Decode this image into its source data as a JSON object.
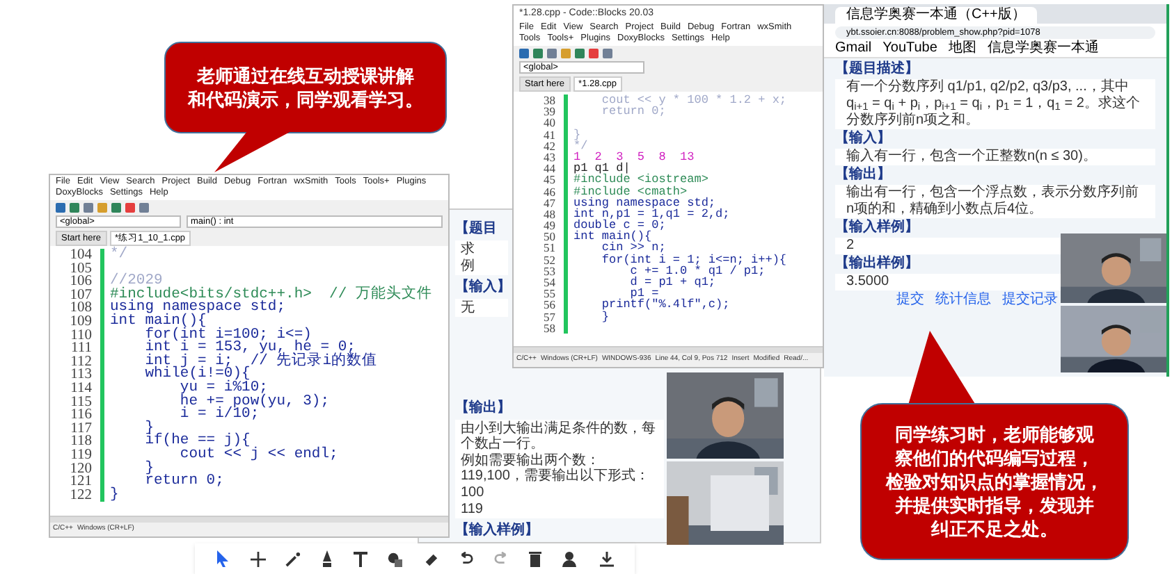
{
  "callouts": [
    {
      "lines": [
        "老师通过在线互动授课讲解",
        "和代码演示，同学观看学习。"
      ]
    },
    {
      "lines": [
        "同学练习时，老师能够观",
        "察他们的代码编写过程，",
        "检验对知识点的掌握情况，",
        "并提供实时指导，发现并",
        "纠正不足之处。"
      ]
    }
  ],
  "back_page": {
    "sections": [
      {
        "heading": "【题目",
        "body": [
          "求",
          "例"
        ]
      },
      {
        "heading": "【输入】",
        "body": [
          "无"
        ]
      },
      {
        "heading": "【输出】",
        "body": [
          "由小到大输出满足条件的数，每个数占一行。",
          "例如需要输出两个数：119,100，需要输出以下形式：",
          "100",
          "119"
        ]
      },
      {
        "heading": "【输入样例】"
      }
    ]
  },
  "left_editor": {
    "menu": [
      "File",
      "Edit",
      "View",
      "Search",
      "Project",
      "Build",
      "Debug",
      "Fortran",
      "wxSmith",
      "Tools",
      "Tools+",
      "Plugins",
      "DoxyBlocks",
      "Settings",
      "Help"
    ],
    "scope": "<global>",
    "function": "main() : int",
    "tabs": [
      {
        "label": "Start here",
        "selected": false
      },
      {
        "label": "*练习1_10_1.cpp",
        "selected": true
      }
    ],
    "lines": [
      {
        "no": "104",
        "kind": "comment",
        "text": "*/"
      },
      {
        "no": "105"
      },
      {
        "no": "106",
        "kind": "comment",
        "text": "//2029"
      },
      {
        "no": "107",
        "kind": "preproc",
        "text": "#include<bits/stdc++.h>  // 万能头文件"
      },
      {
        "no": "108",
        "kind": "code",
        "text": "using namespace std;"
      },
      {
        "no": "109",
        "kind": "code",
        "text": "int main(){"
      },
      {
        "no": "110",
        "kind": "code",
        "text": "    for(int i=100; i<=)"
      },
      {
        "no": "111",
        "kind": "code",
        "text": "    int i = 153, yu, he = 0;"
      },
      {
        "no": "112",
        "kind": "code",
        "text": "    int j = i;  // 先记录i的数值"
      },
      {
        "no": "113",
        "kind": "code",
        "text": "    while(i!=0){"
      },
      {
        "no": "114",
        "kind": "code",
        "text": "        yu = i%10;"
      },
      {
        "no": "115",
        "kind": "code",
        "text": "        he += pow(yu, 3);"
      },
      {
        "no": "116",
        "kind": "code",
        "text": "        i = i/10;"
      },
      {
        "no": "117",
        "kind": "code",
        "text": "    }"
      },
      {
        "no": "118",
        "kind": "code",
        "text": "    if(he == j){"
      },
      {
        "no": "119",
        "kind": "code",
        "text": "        cout << j << endl;"
      },
      {
        "no": "120",
        "kind": "code",
        "text": "    }"
      },
      {
        "no": "121",
        "kind": "code",
        "text": "    return 0;"
      },
      {
        "no": "122",
        "kind": "code",
        "text": "}"
      }
    ],
    "status": [
      "C/C++",
      "Windows (CR+LF)"
    ]
  },
  "mid_editor": {
    "title": "*1.28.cpp - Code::Blocks 20.03",
    "menu": [
      "File",
      "Edit",
      "View",
      "Search",
      "Project",
      "Build",
      "Debug",
      "Fortran",
      "wxSmith",
      "Tools",
      "Tools+",
      "Plugins",
      "DoxyBlocks",
      "Settings",
      "Help"
    ],
    "scope": "<global>",
    "tabs": [
      {
        "label": "Start here",
        "selected": false
      },
      {
        "label": "*1.28.cpp",
        "selected": true
      }
    ],
    "lines": [
      {
        "no": "38",
        "kind": "comment",
        "text": "    cout << y * 100 * 1.2 + x;"
      },
      {
        "no": "39",
        "kind": "comment",
        "text": "    return 0;"
      },
      {
        "no": "40"
      },
      {
        "no": "41",
        "kind": "comment",
        "text": "}"
      },
      {
        "no": "42",
        "kind": "comment",
        "text": "*/"
      },
      {
        "no": "43",
        "kind": "number",
        "text": "1  2  3  5  8  13"
      },
      {
        "no": "44",
        "kind": "plain",
        "text": "p1 q1 d|"
      },
      {
        "no": "45",
        "kind": "preproc",
        "text": "#include <iostream>"
      },
      {
        "no": "46",
        "kind": "preproc",
        "text": "#include <cmath>"
      },
      {
        "no": "47",
        "kind": "code",
        "text": "using namespace std;"
      },
      {
        "no": "48",
        "kind": "code",
        "text": "int n,p1 = 1,q1 = 2,d;"
      },
      {
        "no": "49",
        "kind": "code",
        "text": "double c = 0;"
      },
      {
        "no": "50",
        "kind": "code",
        "text": "int main(){"
      },
      {
        "no": "51",
        "kind": "code",
        "text": "    cin >> n;"
      },
      {
        "no": "52",
        "kind": "code",
        "text": "    for(int i = 1; i<=n; i++){"
      },
      {
        "no": "53",
        "kind": "code",
        "text": "        c += 1.0 * q1 / p1;"
      },
      {
        "no": "54",
        "kind": "code",
        "text": "        d = p1 + q1;"
      },
      {
        "no": "55",
        "kind": "code",
        "text": "        p1 ="
      },
      {
        "no": "56",
        "kind": "code",
        "text": "    printf(\"%.4lf\",c);"
      },
      {
        "no": "57",
        "kind": "code",
        "text": "    }"
      },
      {
        "no": "58"
      }
    ],
    "status": [
      "C/C++",
      "Windows (CR+LF)",
      "WINDOWS-936",
      "Line 44, Col 9, Pos 712",
      "Insert",
      "Modified",
      "Read/..."
    ]
  },
  "browser": {
    "tab": "信息学奥赛一本通（C++版）",
    "url": "ybt.ssoier.cn:8088/problem_show.php?pid=1078",
    "bookmarks": [
      "Gmail",
      "YouTube",
      "地图",
      "信息学奥赛一本通"
    ],
    "sections": [
      {
        "heading": "【题目描述】",
        "body": [
          "有一个分数序列 q1/p1, q2/p2, q3/p3, ...，其中q$_{i+1}$ = q$_{i}$ + p$_{i}$，p$_{i+1}$ = q$_{i}$，p$_{1}$ = 1，q$_{1}$ = 2。求这个分数序列前n项之和。"
        ]
      },
      {
        "heading": "【输入】",
        "body": [
          "输入有一行，包含一个正整数n(n ≤ 30)。"
        ]
      },
      {
        "heading": "【输出】",
        "body": [
          "输出有一行，包含一个浮点数，表示分数序列前n项的和，精确到小数点后4位。"
        ]
      },
      {
        "heading": "【输入样例】",
        "body": [
          "2"
        ]
      },
      {
        "heading": "【输出样例】",
        "body": [
          "3.5000"
        ]
      }
    ],
    "links": [
      "提交",
      "统计信息",
      "提交记录"
    ]
  }
}
